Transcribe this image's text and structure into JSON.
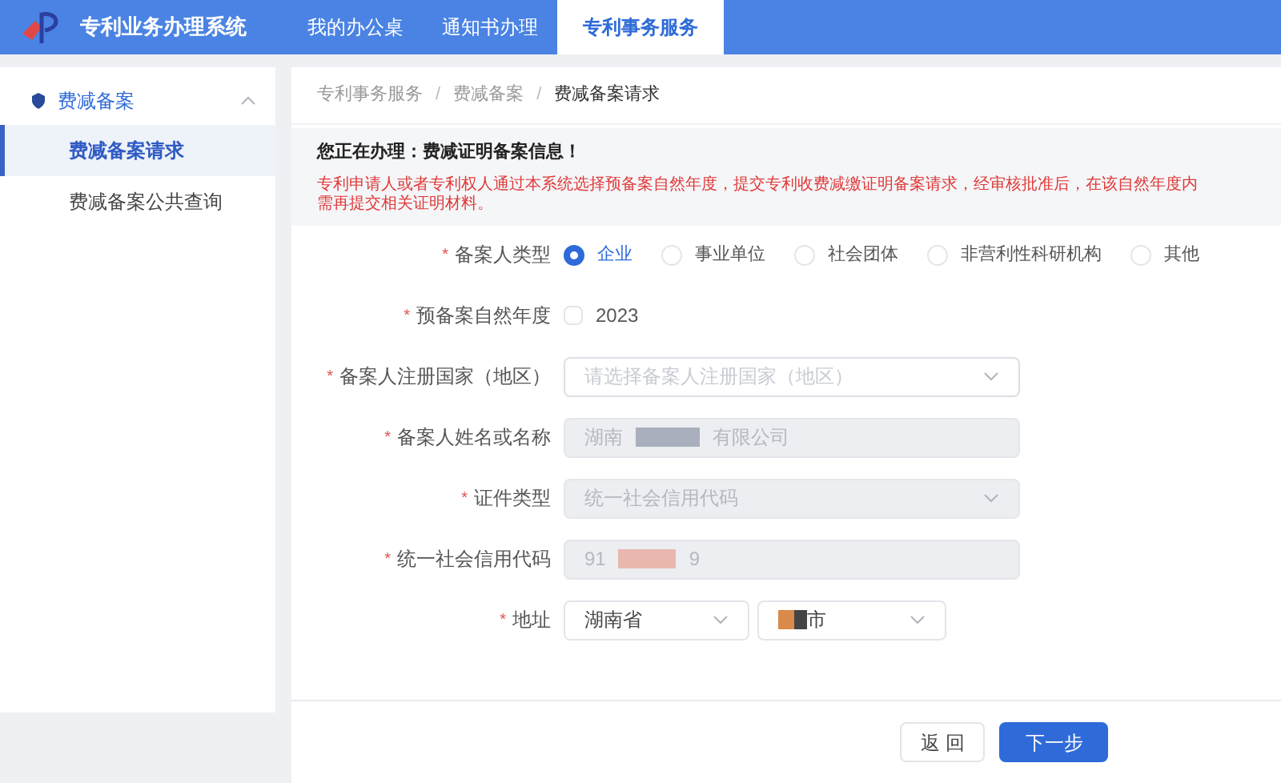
{
  "header": {
    "title": "专利业务办理系统",
    "tabs": [
      {
        "label": "我的办公桌",
        "selected": false
      },
      {
        "label": "通知书办理",
        "selected": false
      },
      {
        "label": "专利事务服务",
        "selected": true
      }
    ]
  },
  "sidebar": {
    "group": {
      "label": "费减备案",
      "expanded": true,
      "children": [
        {
          "label": "费减备案请求",
          "selected": true
        },
        {
          "label": "费减备案公共查询",
          "selected": false
        }
      ]
    }
  },
  "breadcrumb": [
    "专利事务服务",
    "费减备案",
    "费减备案请求"
  ],
  "breadcrumb_separator": "/",
  "notice": {
    "title": "您正在办理：费减证明备案信息！",
    "lines": [
      "专利申请人或者专利权人通过本系统选择预备案自然年度，提交专利收费减缴证明备案请求，经审核批准后，在该自然年度内",
      "需再提交相关证明材料。"
    ]
  },
  "fields": [
    {
      "kind": "radio",
      "mark": "*",
      "label": "备案人类型",
      "options": [
        {
          "label": "企业",
          "selected": true
        },
        {
          "label": "事业单位",
          "selected": false
        },
        {
          "label": "社会团体",
          "selected": false
        },
        {
          "label": "非营利性科研机构",
          "selected": false
        },
        {
          "label": "其他",
          "selected": false
        }
      ]
    },
    {
      "kind": "checkbox",
      "mark": "*",
      "label": "预备案自然年度",
      "options": [
        {
          "label": "2023",
          "checked": false
        }
      ]
    },
    {
      "kind": "select",
      "mark": "*",
      "label": "备案人注册国家（地区）",
      "placeholder": "请选择备案人注册国家（地区）",
      "disabled": false
    },
    {
      "kind": "text",
      "mark": "*",
      "label": "备案人姓名或名称",
      "value_start": "湖南",
      "value_end": "有限公司",
      "redacted": true,
      "disabled": true
    },
    {
      "kind": "select",
      "mark": "*",
      "label": "证件类型",
      "value": "统一社会信用代码",
      "disabled": true
    },
    {
      "kind": "text",
      "mark": "*",
      "label": "统一社会信用代码",
      "value_start": "91",
      "value_end": "9",
      "redacted": true,
      "disabled": true
    },
    {
      "kind": "address",
      "mark": "*",
      "label": "地址",
      "selects": [
        {
          "value": "湖南省",
          "redacted": false
        },
        {
          "value": "市",
          "redacted": true
        }
      ]
    }
  ],
  "buttons": [
    {
      "label": "返 回",
      "kind": "secondary"
    },
    {
      "label": "下一步",
      "kind": "primary"
    }
  ]
}
